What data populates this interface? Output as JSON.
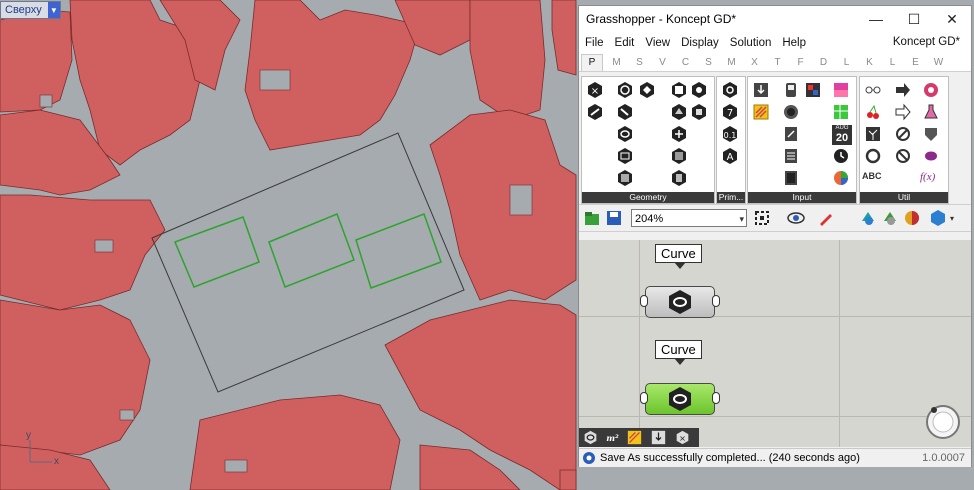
{
  "viewport": {
    "label": "Сверху",
    "axis_x": "x",
    "axis_y": "y"
  },
  "gh": {
    "title": "Grasshopper - Koncept GD*",
    "window_buttons": {
      "minimize": "—",
      "maximize": "☐",
      "close": "✕"
    },
    "menu": [
      "File",
      "Edit",
      "View",
      "Display",
      "Solution",
      "Help"
    ],
    "document_name": "Koncept GD*",
    "tabs": [
      "P",
      "M",
      "S",
      "V",
      "C",
      "S",
      "M",
      "X",
      "T",
      "F",
      "D",
      "L",
      "K",
      "L",
      "E",
      "W"
    ],
    "panels": {
      "geometry": "Geometry",
      "prim": "Prim...",
      "input": "Input",
      "util": "Util",
      "cal_month": "AUG",
      "cal_day": "20",
      "abc": "ABC",
      "fx": "f(x)"
    },
    "zoom": "204%",
    "canvas": {
      "bubble1": "Curve",
      "bubble2": "Curve"
    },
    "status": "Save As successfully completed... (240 seconds ago)",
    "version": "1.0.0007"
  }
}
